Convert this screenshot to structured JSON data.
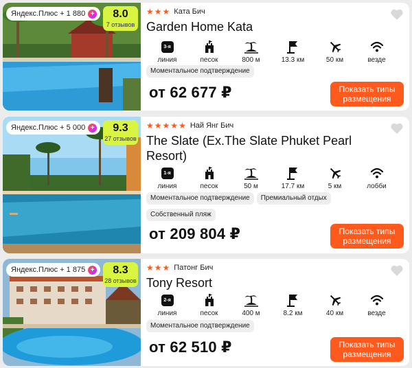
{
  "hotels": [
    {
      "plus_text": "Яндекс.Плюс + 1 880",
      "plus_icon": "plus-points-icon",
      "rating": "8.0",
      "reviews": "7 отзывов",
      "stars": 3,
      "beach": "Ката Бич",
      "name": "Garden Home Kata",
      "features": [
        {
          "icon": "beach-line-badge",
          "badge": "3-я",
          "label": "линия"
        },
        {
          "icon": "sand-castle-icon",
          "label": "песок"
        },
        {
          "icon": "island-icon",
          "label": "800 м"
        },
        {
          "icon": "flag-icon",
          "label": "13.3 км"
        },
        {
          "icon": "airplane-icon",
          "label": "50 км"
        },
        {
          "icon": "wifi-icon",
          "label": "везде"
        }
      ],
      "tags": [
        "Моментальное подтверждение"
      ],
      "price": "от 62 677 ₽",
      "button": "Показать типы размещения"
    },
    {
      "plus_text": "Яндекс.Плюс + 5 000",
      "plus_icon": "plus-points-icon",
      "rating": "9.3",
      "reviews": "27 отзывов",
      "stars": 5,
      "beach": "Най Янг Бич",
      "name": "The Slate (Ex.The Slate Phuket Pearl Resort)",
      "features": [
        {
          "icon": "beach-line-badge",
          "badge": "1-я",
          "label": "линия"
        },
        {
          "icon": "sand-castle-icon",
          "label": "песок"
        },
        {
          "icon": "island-icon",
          "label": "50 м"
        },
        {
          "icon": "flag-icon",
          "label": "17.7 км"
        },
        {
          "icon": "airplane-icon",
          "label": "5 км"
        },
        {
          "icon": "wifi-icon",
          "label": "лобби"
        }
      ],
      "tags": [
        "Моментальное подтверждение",
        "Премиальный отдых",
        "Собственный пляж"
      ],
      "price": "от 209 804 ₽",
      "button": "Показать типы размещения"
    },
    {
      "plus_text": "Яндекс.Плюс + 1 875",
      "plus_icon": "plus-points-icon",
      "rating": "8.3",
      "reviews": "28 отзывов",
      "stars": 3,
      "beach": "Патонг Бич",
      "name": "Tony Resort",
      "features": [
        {
          "icon": "beach-line-badge",
          "badge": "2-я",
          "label": "линия"
        },
        {
          "icon": "sand-castle-icon",
          "label": "песок"
        },
        {
          "icon": "island-icon",
          "label": "400 м"
        },
        {
          "icon": "flag-icon",
          "label": "8.2 км"
        },
        {
          "icon": "airplane-icon",
          "label": "40 км"
        },
        {
          "icon": "wifi-icon",
          "label": "везде"
        }
      ],
      "tags": [
        "Моментальное подтверждение"
      ],
      "price": "от 62 510 ₽",
      "button": "Показать типы размещения"
    }
  ],
  "colors": {
    "accent": "#ff5a1e",
    "rating_bg": "#d9f441",
    "tag_bg": "#eeeeee",
    "page_bg": "#ececec"
  }
}
